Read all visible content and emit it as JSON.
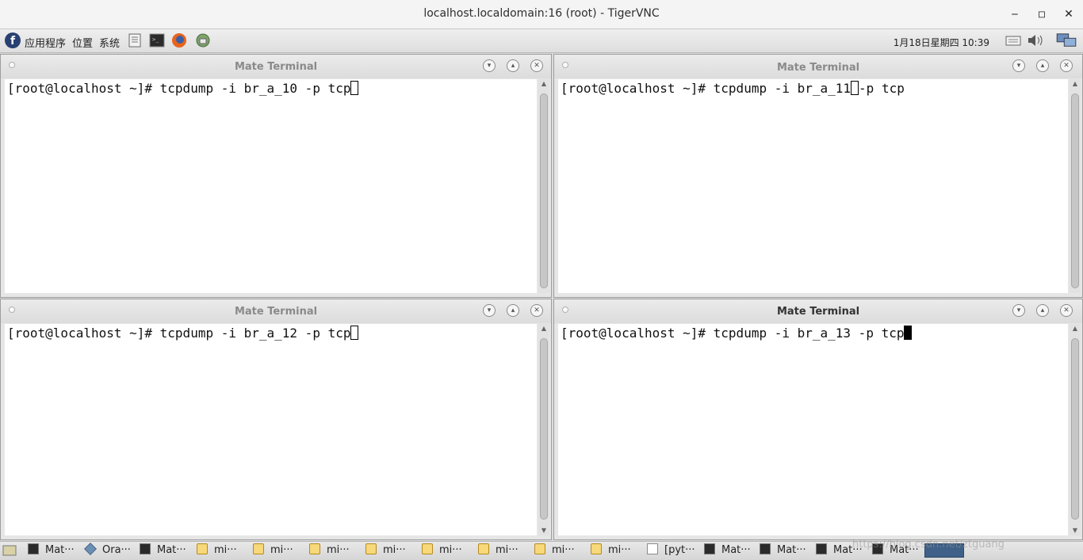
{
  "window": {
    "title": "localhost.localdomain:16 (root) - TigerVNC",
    "minimize": "‒",
    "maximize": "◽",
    "close": "✕"
  },
  "top_panel": {
    "menu": [
      "应用程序",
      "位置",
      "系统"
    ],
    "launchers": [
      "text-editor-icon",
      "terminal-icon",
      "firefox-icon",
      "network-tool-icon"
    ],
    "clock": "1月18日星期四 10:39",
    "tray": [
      "keyboard-icon",
      "volume-icon",
      "network-icon"
    ]
  },
  "terminals": [
    {
      "title": "Mate Terminal",
      "prompt": "[root@localhost ~]# ",
      "command_before": "tcpdump -i br_a_10 -p tcp",
      "command_after": "",
      "cursor": "hollow",
      "active": false
    },
    {
      "title": "Mate Terminal",
      "prompt": "[root@localhost ~]# ",
      "command_before": "tcpdump -i br_a_11",
      "command_after": "-p tcp",
      "cursor": "hollow",
      "active": false
    },
    {
      "title": "Mate Terminal",
      "prompt": "[root@localhost ~]# ",
      "command_before": "tcpdump -i br_a_12 -p tcp",
      "command_after": "",
      "cursor": "hollow",
      "active": false
    },
    {
      "title": "Mate Terminal",
      "prompt": "[root@localhost ~]# ",
      "command_before": "tcpdump -i br_a_13 -p tcp",
      "command_after": "",
      "cursor": "solid",
      "active": true
    }
  ],
  "taskbar": {
    "tasks": [
      {
        "icon": "terminal-icon",
        "label": "Mat···"
      },
      {
        "icon": "virtualbox-icon",
        "label": "Ora···"
      },
      {
        "icon": "terminal-icon",
        "label": "Mat···"
      },
      {
        "icon": "mi-icon",
        "label": "mi···"
      },
      {
        "icon": "mi-icon",
        "label": "mi···"
      },
      {
        "icon": "mi-icon",
        "label": "mi···"
      },
      {
        "icon": "mi-icon",
        "label": "mi···"
      },
      {
        "icon": "mi-icon",
        "label": "mi···"
      },
      {
        "icon": "mi-icon",
        "label": "mi···"
      },
      {
        "icon": "mi-icon",
        "label": "mi···"
      },
      {
        "icon": "mi-icon",
        "label": "mi···"
      },
      {
        "icon": "window-icon",
        "label": "[pyt···"
      },
      {
        "icon": "terminal-icon",
        "label": "Mat···"
      },
      {
        "icon": "terminal-icon",
        "label": "Mat···"
      },
      {
        "icon": "terminal-icon",
        "label": "Mat···"
      },
      {
        "icon": "terminal-icon",
        "label": "Mat···"
      }
    ],
    "watermark": "https://blog.csdn.net/ztguang"
  },
  "colors": {
    "workspace_active": "#3f6088",
    "terminal_bg": "#ffffff"
  }
}
